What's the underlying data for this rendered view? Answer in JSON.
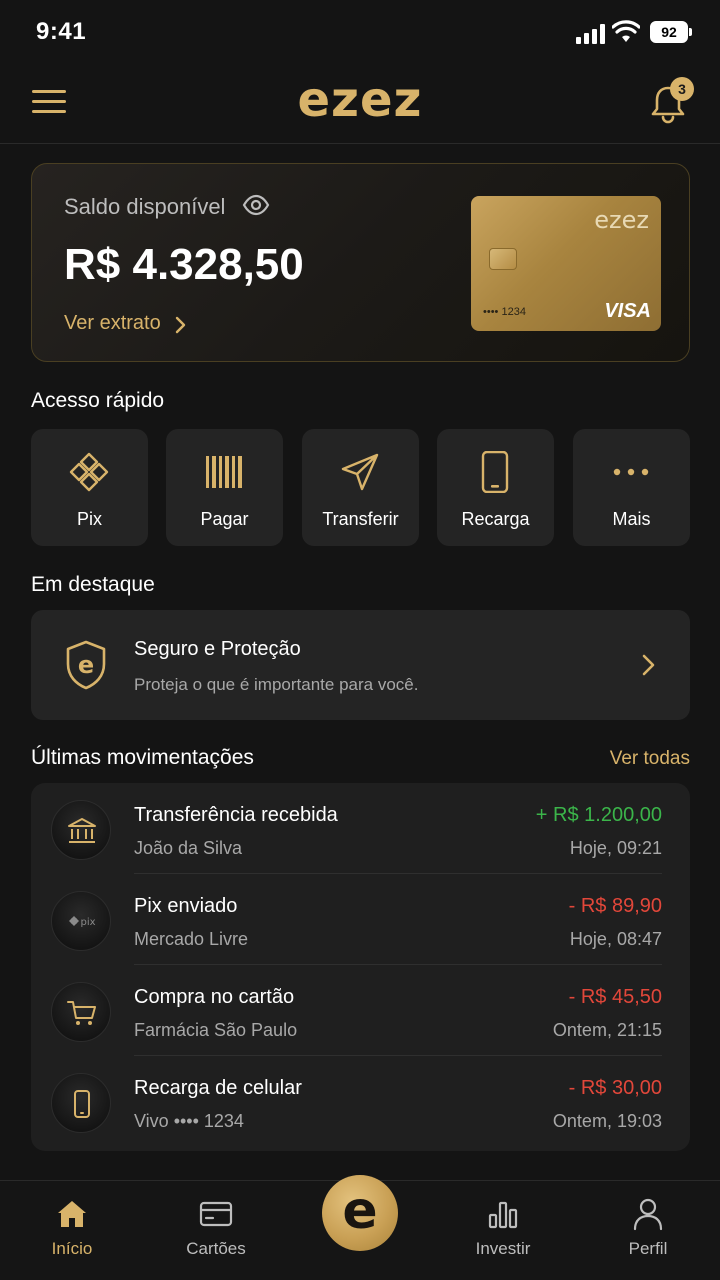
{
  "status_bar": {
    "time": "9:41",
    "battery": "92"
  },
  "header": {
    "logo": "ezez",
    "notification_count": "3"
  },
  "balance": {
    "label": "Saldo disponível",
    "value": "R$ 4.328,50",
    "extract_link": "Ver extrato",
    "card": {
      "logo": "ezez",
      "number": "•••• 1234",
      "brand": "VISA"
    }
  },
  "quick_access": {
    "title": "Acesso rápido",
    "items": [
      {
        "label": "Pix",
        "icon": "pix-icon"
      },
      {
        "label": "Pagar",
        "icon": "barcode-icon"
      },
      {
        "label": "Transferir",
        "icon": "send-icon"
      },
      {
        "label": "Recarga",
        "icon": "phone-icon"
      },
      {
        "label": "Mais",
        "icon": "more-icon"
      }
    ]
  },
  "highlight": {
    "title": "Em destaque",
    "card_title": "Seguro e Proteção",
    "card_subtitle": "Proteja o que é importante para você."
  },
  "transactions": {
    "title": "Últimas movimentações",
    "see_all": "Ver todas",
    "items": [
      {
        "title": "Transferência recebida",
        "subtitle": "João da Silva",
        "amount": "+ R$ 1.200,00",
        "time": "Hoje, 09:21",
        "type": "positive",
        "icon": "bank-icon"
      },
      {
        "title": "Pix enviado",
        "subtitle": "Mercado Livre",
        "amount": "- R$ 89,90",
        "time": "Hoje, 08:47",
        "type": "negative",
        "icon": "pix-icon"
      },
      {
        "title": "Compra no cartão",
        "subtitle": "Farmácia São Paulo",
        "amount": "- R$ 45,50",
        "time": "Ontem, 21:15",
        "type": "negative",
        "icon": "cart-icon"
      },
      {
        "title": "Recarga de celular",
        "subtitle": "Vivo •••• 1234",
        "amount": "- R$ 30,00",
        "time": "Ontem, 19:03",
        "type": "negative",
        "icon": "phone-icon"
      }
    ]
  },
  "bottom_nav": {
    "items": [
      {
        "label": "Início",
        "icon": "home-icon",
        "active": true
      },
      {
        "label": "Cartões",
        "icon": "card-icon",
        "active": false
      },
      {
        "label": "Investir",
        "icon": "chart-icon",
        "active": false
      },
      {
        "label": "Perfil",
        "icon": "user-icon",
        "active": false
      }
    ],
    "center_label": "e"
  },
  "colors": {
    "accent": "#d8b36a",
    "background": "#141414",
    "positive": "#3bb54a",
    "negative": "#e2473a"
  }
}
